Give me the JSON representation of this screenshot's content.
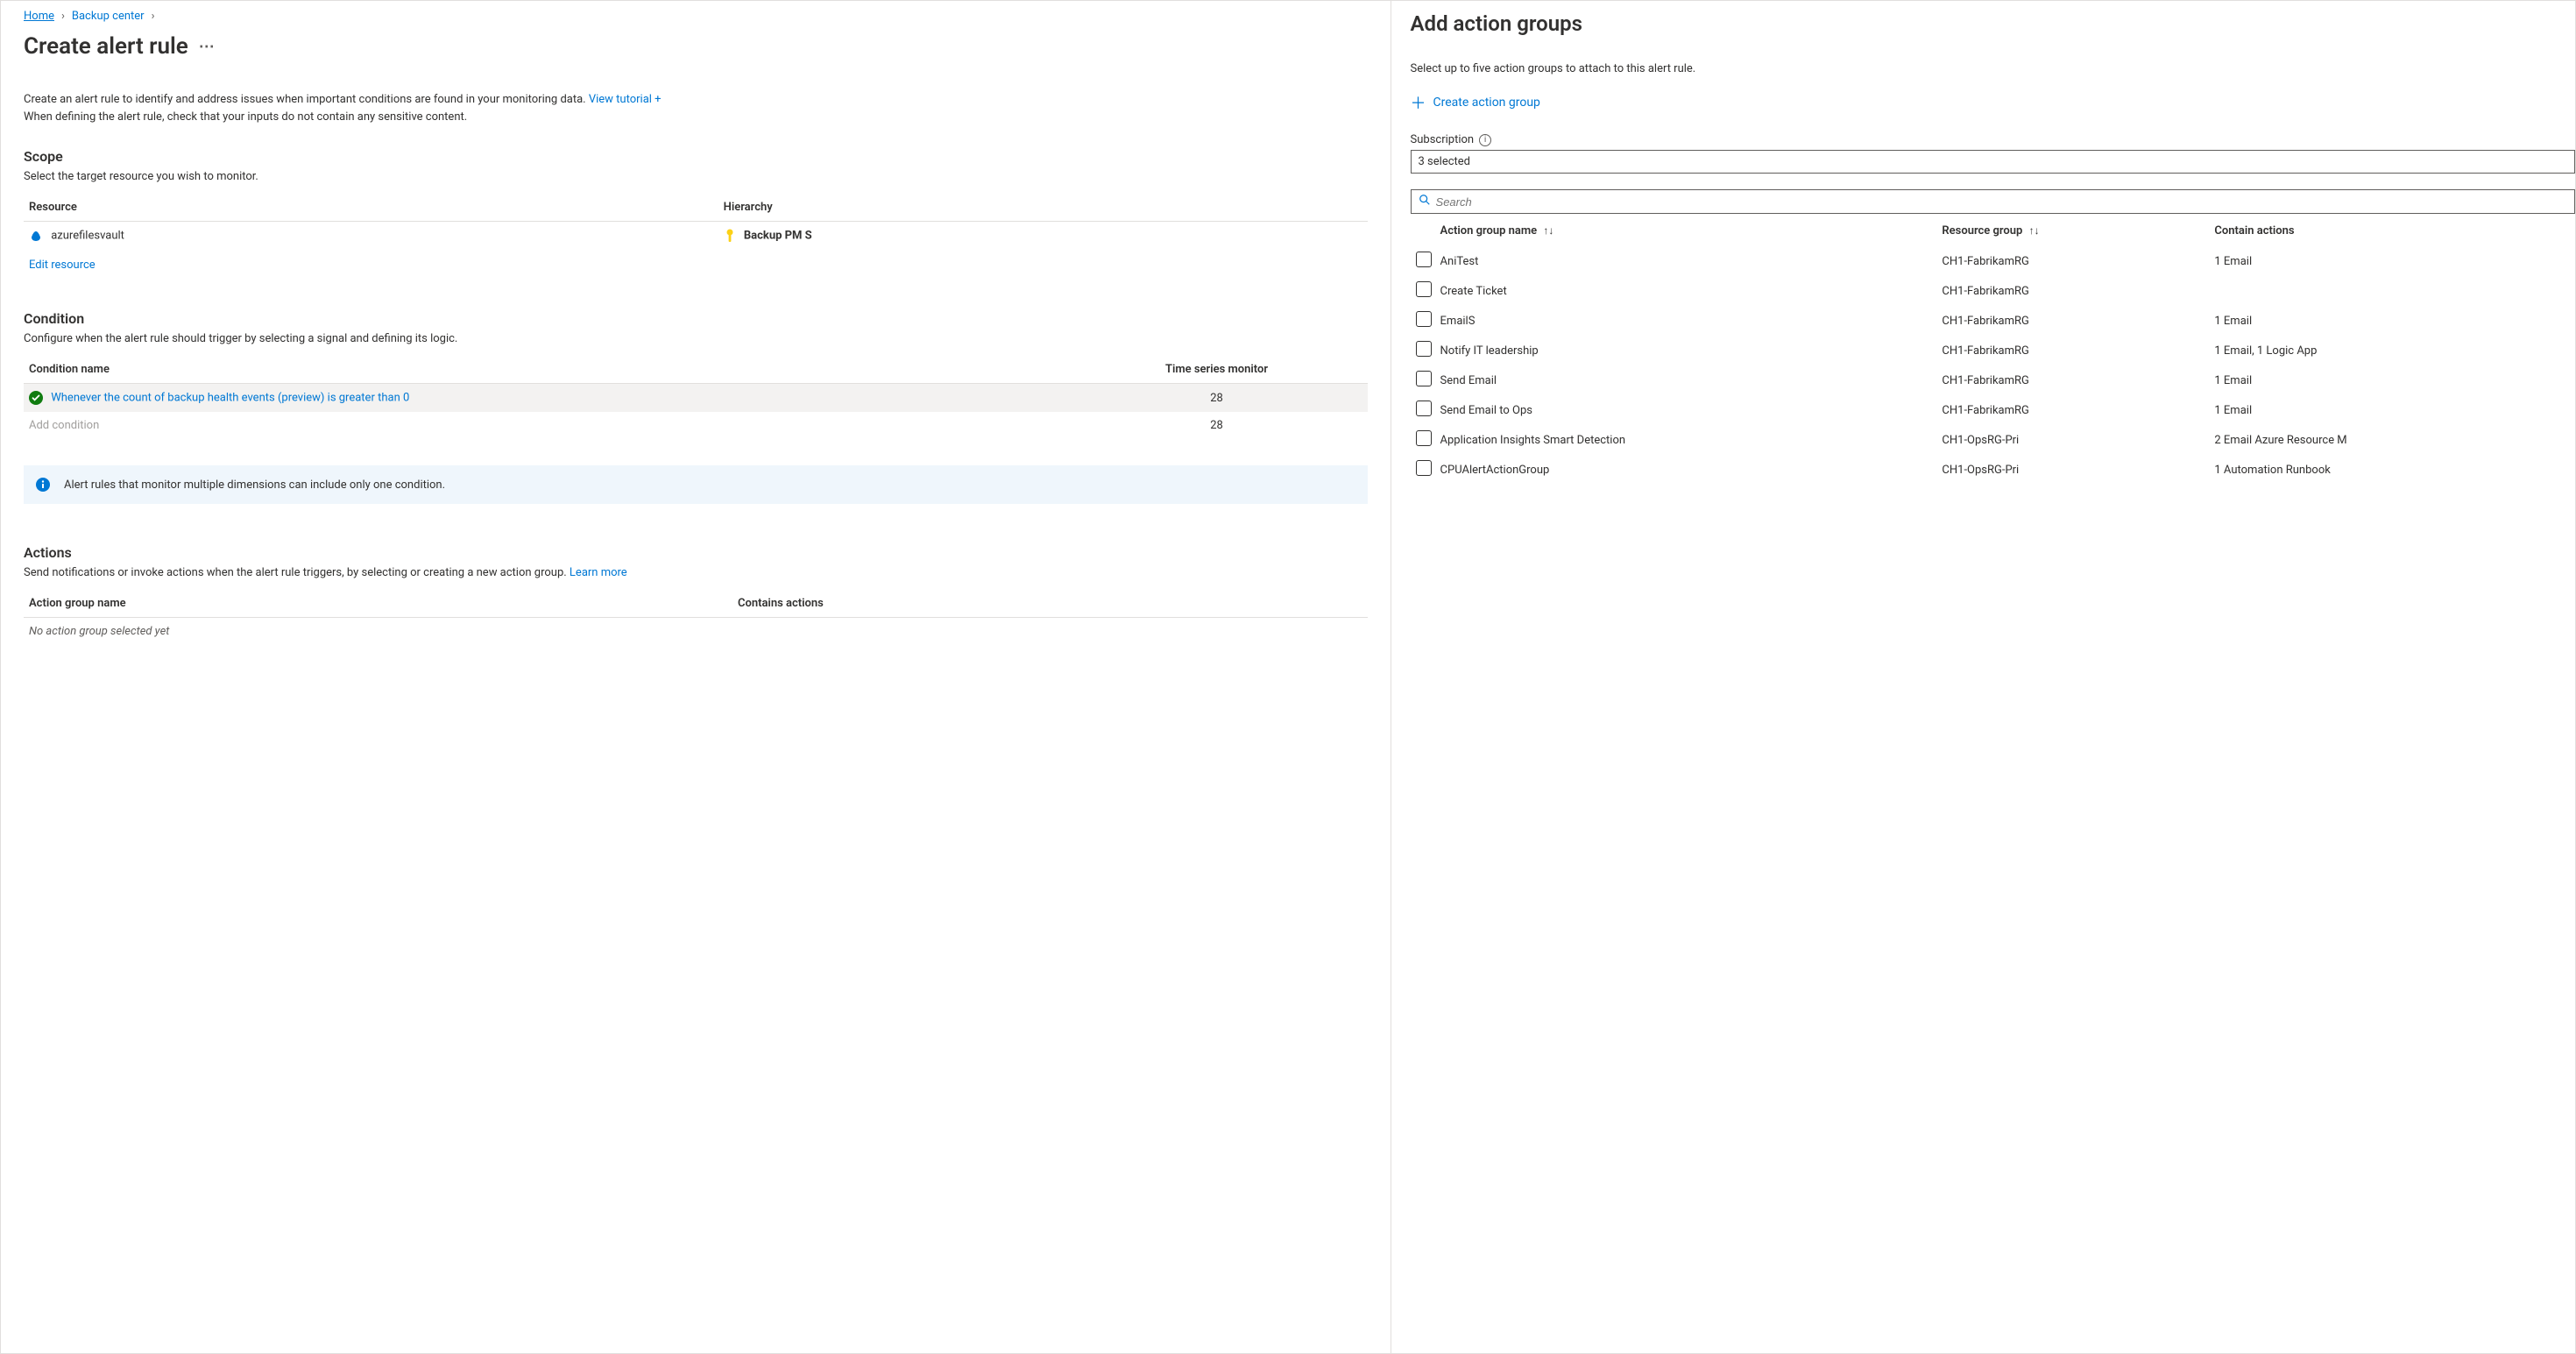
{
  "breadcrumb": {
    "home": "Home",
    "second": "Backup center"
  },
  "page_title": "Create alert rule",
  "intro": {
    "line1": "Create an alert rule to identify and address issues when important conditions are found in your monitoring data.",
    "tutorial": "View tutorial +",
    "line2": "When defining the alert rule, check that your inputs do not contain any sensitive content."
  },
  "scope": {
    "heading": "Scope",
    "sub": "Select the target resource you wish to monitor.",
    "col_resource": "Resource",
    "col_hierarchy": "Hierarchy",
    "resource_name": "azurefilesvault",
    "hierarchy": "Backup PM S",
    "edit": "Edit resource"
  },
  "condition": {
    "heading": "Condition",
    "sub": "Configure when the alert rule should trigger by selecting a signal and defining its logic.",
    "col_name": "Condition name",
    "col_ts": "Time series monitor",
    "row1_name": "Whenever the count of backup health events (preview) is greater than 0",
    "row1_ts": "28",
    "add": "Add condition",
    "row2_ts": "28",
    "info": "Alert rules that monitor multiple dimensions can include only one condition."
  },
  "actions": {
    "heading": "Actions",
    "sub_pre": "Send notifications or invoke actions when the alert rule triggers, by selecting or creating a new action group.",
    "learn": "Learn more",
    "col_name": "Action group name",
    "col_contains": "Contains actions",
    "empty": "No action group selected yet"
  },
  "blade": {
    "title": "Add action groups",
    "sub": "Select up to five action groups to attach to this alert rule.",
    "create": "Create action group",
    "subscription_label": "Subscription",
    "subscription_value": "3 selected",
    "search_placeholder": "Search",
    "col_name": "Action group name",
    "col_rg": "Resource group",
    "col_actions": "Contain actions",
    "rows": [
      {
        "name": "AniTest",
        "rg": "CH1-FabrikamRG",
        "actions": "1 Email"
      },
      {
        "name": "Create Ticket",
        "rg": "CH1-FabrikamRG",
        "actions": ""
      },
      {
        "name": "EmailS",
        "rg": "CH1-FabrikamRG",
        "actions": "1 Email"
      },
      {
        "name": "Notify IT leadership",
        "rg": "CH1-FabrikamRG",
        "actions": "1 Email, 1 Logic App"
      },
      {
        "name": "Send Email",
        "rg": "CH1-FabrikamRG",
        "actions": "1 Email"
      },
      {
        "name": "Send Email to Ops",
        "rg": "CH1-FabrikamRG",
        "actions": "1 Email"
      },
      {
        "name": "Application Insights Smart Detection",
        "rg": "CH1-OpsRG-Pri",
        "actions": "2 Email Azure Resource M"
      },
      {
        "name": "CPUAlertActionGroup",
        "rg": "CH1-OpsRG-Pri",
        "actions": "1 Automation Runbook"
      }
    ]
  }
}
